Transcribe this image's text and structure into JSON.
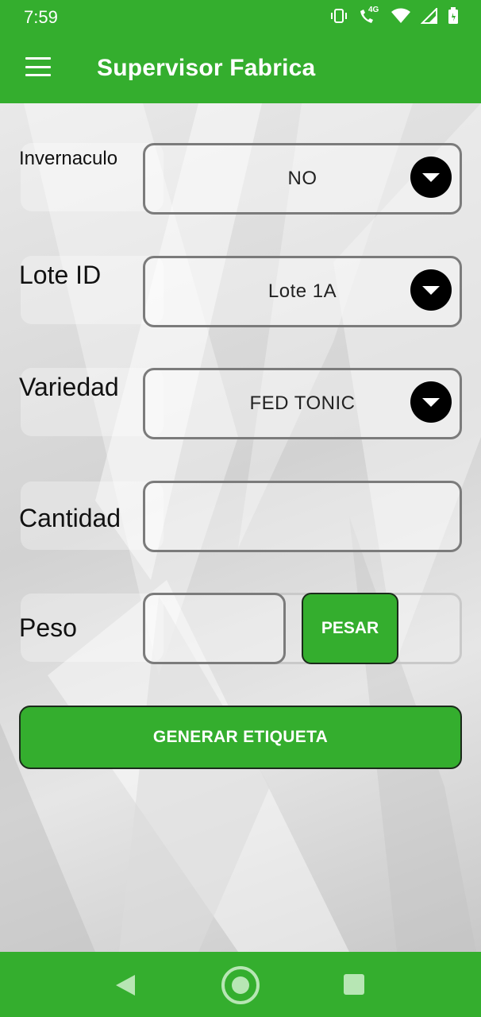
{
  "status_bar": {
    "time": "7:59",
    "icons": [
      "vibrate-icon",
      "wifi-calling-icon",
      "wifi-icon",
      "cell-signal-icon",
      "battery-icon"
    ],
    "network_label": "4G"
  },
  "app_bar": {
    "title": "Supervisor Fabrica",
    "menu_icon": "hamburger-menu-icon"
  },
  "form": {
    "invernaculo": {
      "label": "Invernaculo",
      "value": "NO"
    },
    "lote": {
      "label": "Lote ID",
      "value": "Lote 1A"
    },
    "variedad": {
      "label": "Variedad",
      "value": "FED TONIC"
    },
    "cantidad": {
      "label": "Cantidad",
      "value": ""
    },
    "peso": {
      "label": "Peso",
      "value": "",
      "button": "PESAR"
    },
    "submit": "GENERAR ETIQUETA"
  },
  "colors": {
    "primary_green": "#34ae2e",
    "nav_icon": "#b7e6b4"
  },
  "nav_bar": {
    "back_icon": "back-triangle-icon",
    "home_icon": "home-circle-icon",
    "recents_icon": "recents-square-icon"
  }
}
